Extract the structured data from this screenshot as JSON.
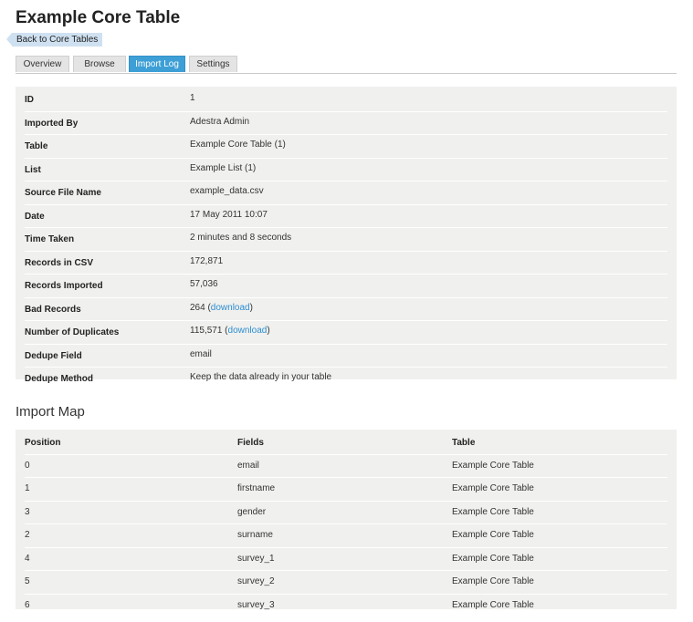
{
  "page": {
    "title": "Example Core Table",
    "back_link": "Back to Core Tables"
  },
  "tabs": [
    {
      "label": "Overview",
      "active": false
    },
    {
      "label": "Browse",
      "active": false
    },
    {
      "label": "Import Log",
      "active": true
    },
    {
      "label": "Settings",
      "active": false
    }
  ],
  "details": {
    "id": {
      "label": "ID",
      "value": "1"
    },
    "imported_by": {
      "label": "Imported By",
      "value": "Adestra Admin"
    },
    "table": {
      "label": "Table",
      "value": "Example Core Table (1)"
    },
    "list": {
      "label": "List",
      "value": "Example List (1)"
    },
    "source_file": {
      "label": "Source File Name",
      "value": "example_data.csv"
    },
    "date": {
      "label": "Date",
      "value": "17 May 2011 10:07"
    },
    "time_taken": {
      "label": "Time Taken",
      "value": "2 minutes and 8 seconds"
    },
    "records_csv": {
      "label": "Records in CSV",
      "value": "172,871"
    },
    "records_imported": {
      "label": "Records Imported",
      "value": "57,036"
    },
    "bad_records": {
      "label": "Bad Records",
      "value": "264",
      "link": "download"
    },
    "duplicates": {
      "label": "Number of Duplicates",
      "value": "115,571",
      "link": "download"
    },
    "dedupe_field": {
      "label": "Dedupe Field",
      "value": "email"
    },
    "dedupe_method": {
      "label": "Dedupe Method",
      "value": "Keep the data already in your table"
    }
  },
  "import_map": {
    "title": "Import Map",
    "headers": {
      "position": "Position",
      "fields": "Fields",
      "table": "Table"
    },
    "rows": [
      {
        "position": "0",
        "field": "email",
        "table": "Example Core Table"
      },
      {
        "position": "1",
        "field": "firstname",
        "table": "Example Core Table"
      },
      {
        "position": "3",
        "field": "gender",
        "table": "Example Core Table"
      },
      {
        "position": "2",
        "field": "surname",
        "table": "Example Core Table"
      },
      {
        "position": "4",
        "field": "survey_1",
        "table": "Example Core Table"
      },
      {
        "position": "5",
        "field": "survey_2",
        "table": "Example Core Table"
      },
      {
        "position": "6",
        "field": "survey_3",
        "table": "Example Core Table"
      }
    ]
  },
  "colors": {
    "accent": "#3d9fd6",
    "link": "#2c8ed1",
    "panel_bg": "#f0f0ee",
    "back_link_bg": "#cfe1f1"
  }
}
